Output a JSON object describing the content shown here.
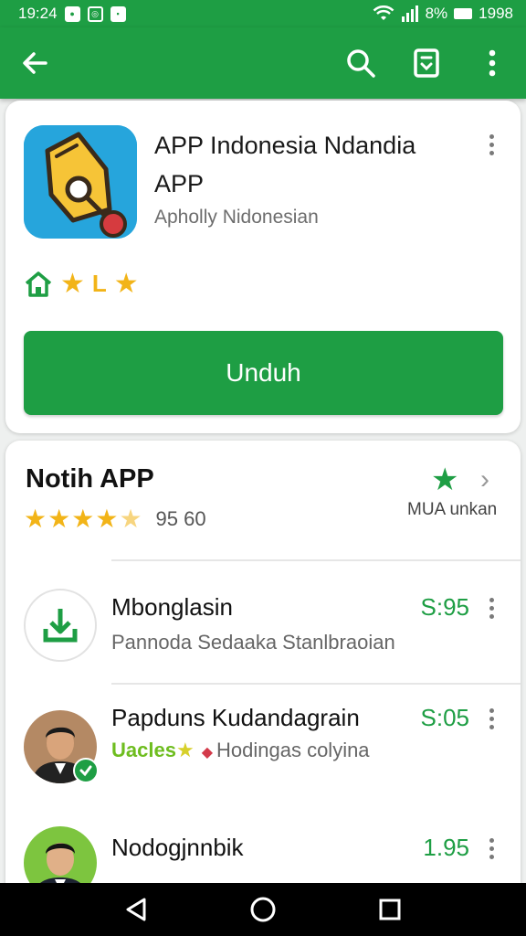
{
  "status": {
    "time": "19:24",
    "battery_pct": "8%",
    "clock_right": "1998",
    "color": "#1e9e44"
  },
  "app_bar": {
    "icons": [
      "back-arrow-icon",
      "search-icon",
      "bookmark-icon",
      "more-vert-icon"
    ]
  },
  "app": {
    "title": "APP Indonesia Ndandia APP",
    "developer": "Apholly Nidonesian",
    "badge_text": "L",
    "install_label": "Unduh"
  },
  "ratings": {
    "section_title": "Notih APP",
    "stars": 4.5,
    "count": "95 60",
    "more_label": "MUA unkan"
  },
  "list": [
    {
      "title": "Mbonglasin",
      "subtitle": "Pannoda Sedaaka Stanlbraoian",
      "price": "S:95"
    },
    {
      "title": "Papduns Kudandagrain",
      "subtitle_tag": "Uacles",
      "subtitle": "Hodingas colyina",
      "price": "S:05"
    },
    {
      "title": "Nodogjnnbik",
      "price": "1.95"
    }
  ],
  "nav": {
    "icons": [
      "back-triangle-icon",
      "home-circle-icon",
      "recents-square-icon"
    ]
  }
}
